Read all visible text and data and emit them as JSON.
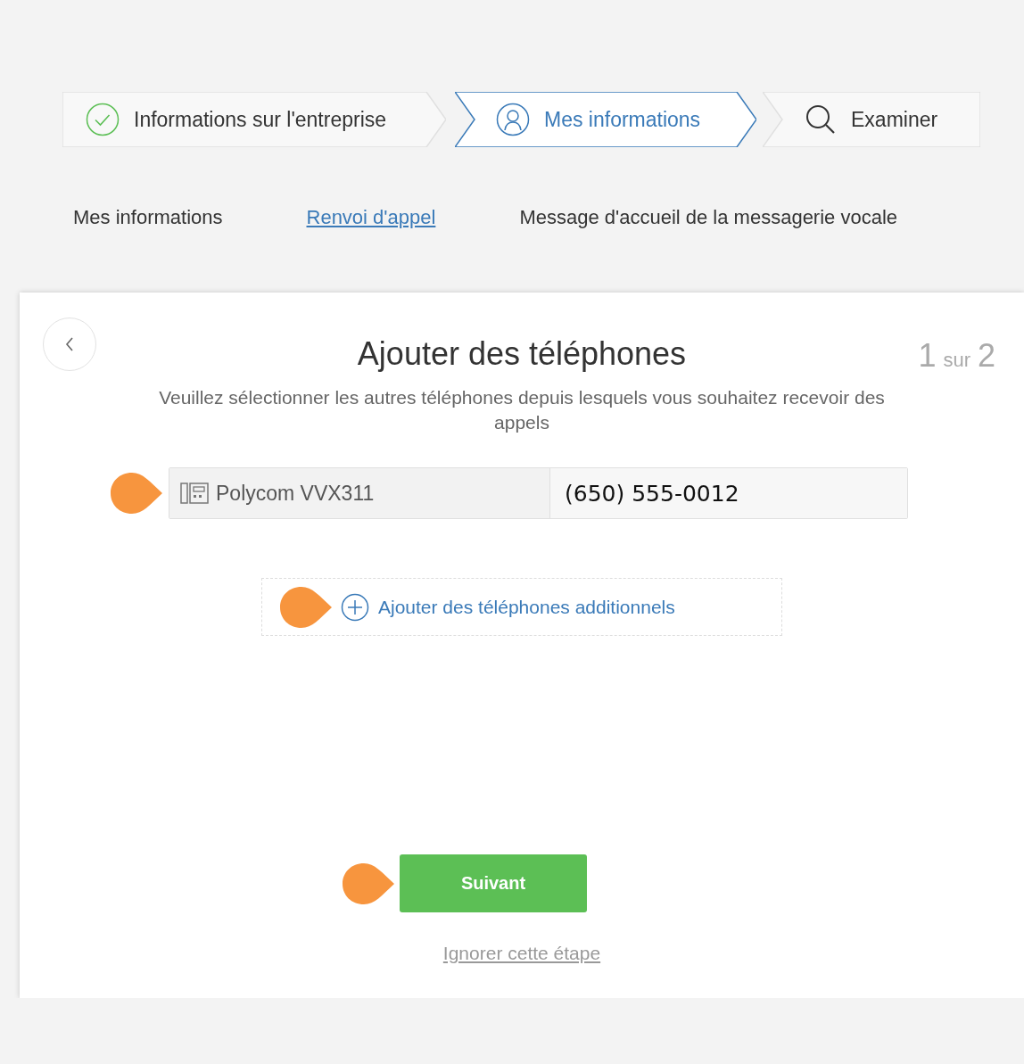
{
  "stepper": [
    {
      "label": "Informations sur l'entreprise",
      "kind": "check",
      "selected": false
    },
    {
      "label": "Mes informations",
      "kind": "person",
      "selected": true
    },
    {
      "label": "Examiner",
      "kind": "search",
      "selected": false
    }
  ],
  "subnav": [
    {
      "label": "Mes informations",
      "selected": false
    },
    {
      "label": "Renvoi d'appel",
      "selected": true
    },
    {
      "label": "Message d'accueil de la messagerie vocale",
      "selected": false
    }
  ],
  "card": {
    "title": "Ajouter des téléphones",
    "step_current": "1",
    "step_separator": "sur",
    "step_total": "2",
    "description": "Veuillez sélectionner les autres téléphones depuis lesquels vous souhaitez recevoir des appels",
    "phones": [
      {
        "device": "Polycom VVX311",
        "number": "(650) 555-0012"
      }
    ],
    "add_phones": "Ajouter des téléphones additionnels",
    "next_button": "Suivant",
    "skip_link": "Ignorer cette étape"
  }
}
